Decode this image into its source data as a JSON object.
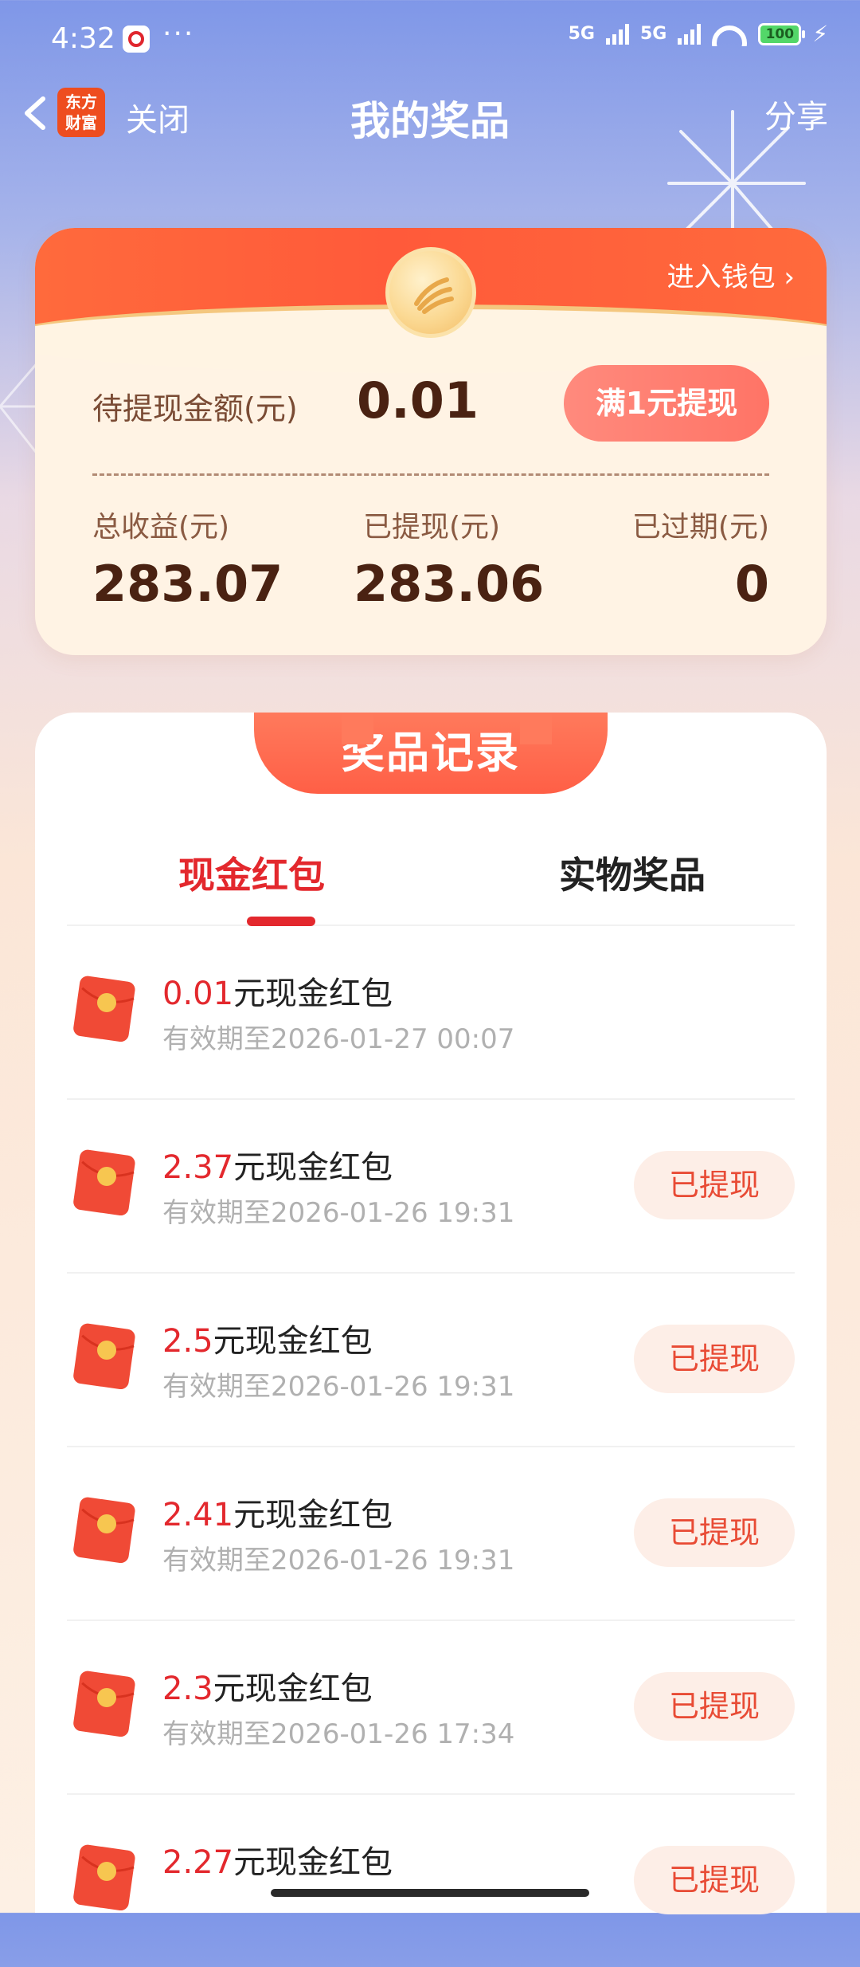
{
  "status_bar": {
    "time": "4:32",
    "dots": "···",
    "net1": "5G",
    "net2": "5G",
    "battery": "100"
  },
  "nav": {
    "logo_line1": "东方",
    "logo_line2": "财富",
    "close_label": "关闭",
    "title": "我的奖品",
    "share_label": "分享"
  },
  "summary": {
    "wallet_link": "进入钱包 ›",
    "pending_label": "待提现金额(元)",
    "pending_value": "0.01",
    "withdraw_button": "满1元提现",
    "total_label": "总收益(元)",
    "total_value": "283.07",
    "withdrawn_label": "已提现(元)",
    "withdrawn_value": "283.06",
    "expired_label": "已过期(元)",
    "expired_value": "0"
  },
  "records": {
    "section_title": "奖品记录",
    "tabs": [
      {
        "label": "现金红包",
        "active": true
      },
      {
        "label": "实物奖品",
        "active": false
      }
    ],
    "suffix": "元现金红包",
    "expiry_prefix": "有效期至",
    "items": [
      {
        "amount": "0.01",
        "suffix": "元现金红包",
        "expiry": "有效期至2026-01-27 00:07",
        "button": ""
      },
      {
        "amount": "2.37",
        "suffix": "元现金红包",
        "expiry": "有效期至2026-01-26 19:31",
        "button": "已提现"
      },
      {
        "amount": "2.5",
        "suffix": "元现金红包",
        "expiry": "有效期至2026-01-26 19:31",
        "button": "已提现"
      },
      {
        "amount": "2.41",
        "suffix": "元现金红包",
        "expiry": "有效期至2026-01-26 19:31",
        "button": "已提现"
      },
      {
        "amount": "2.3",
        "suffix": "元现金红包",
        "expiry": "有效期至2026-01-26 17:34",
        "button": "已提现"
      },
      {
        "amount": "2.27",
        "suffix": "元现金红包",
        "expiry": "",
        "button": "已提现"
      }
    ]
  },
  "colors": {
    "accent_red": "#e3282d",
    "header_orange": "#ff5a3a",
    "withdraw_btn": "#ff7a6c",
    "status_chip_bg": "#fdeee7"
  }
}
